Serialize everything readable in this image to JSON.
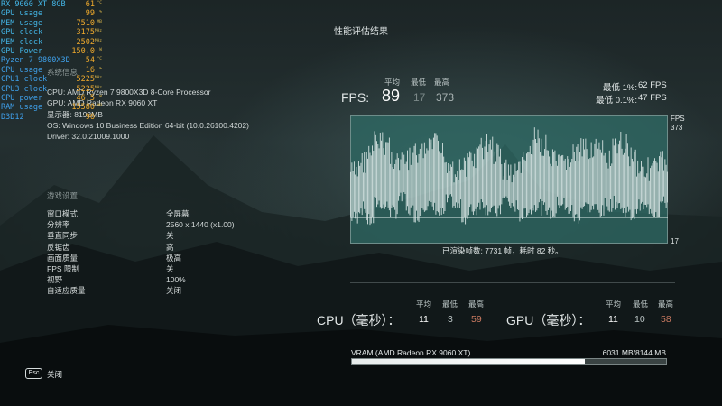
{
  "page": {
    "title": "性能评估结果"
  },
  "osd": [
    {
      "label": "RX 9060 XT 8GB",
      "value": "61",
      "unit": "°C",
      "kind": "gpu"
    },
    {
      "label": "GPU usage",
      "value": "99",
      "unit": "%",
      "kind": "gpu"
    },
    {
      "label": "MEM  usage",
      "value": "7510",
      "unit": "MB",
      "kind": "gpu"
    },
    {
      "label": "GPU clock",
      "value": "3175",
      "unit": "MHz",
      "kind": "gpu"
    },
    {
      "label": "MEM clock",
      "value": "2502",
      "unit": "MHz",
      "kind": "gpu"
    },
    {
      "label": "GPU Power",
      "value": "150.0",
      "unit": "W",
      "kind": "gpu"
    },
    {
      "label": "Ryzen 7 9800X3D",
      "value": "54",
      "unit": "°C",
      "kind": "cpu"
    },
    {
      "label": "CPU usage",
      "value": "16",
      "unit": "%",
      "kind": "cpu"
    },
    {
      "label": "CPU1 clock",
      "value": "5225",
      "unit": "MHz",
      "kind": "cpu"
    },
    {
      "label": "CPU3 clock",
      "value": "5225",
      "unit": "MHz",
      "kind": "cpu"
    },
    {
      "label": "CPU power",
      "value": "46.5",
      "unit": "W",
      "kind": "cpu"
    },
    {
      "label": "RAM usage",
      "value": "15580",
      "unit": "MB",
      "kind": "cpu"
    },
    {
      "label": "D3D12",
      "value": "96",
      "unit": "",
      "kind": "cpu"
    }
  ],
  "system": {
    "heading": "系统信息",
    "lines": [
      "CPU: AMD Ryzen 7 9800X3D 8-Core Processor",
      "GPU: AMD Radeon RX 9060 XT",
      "显示器: 8192MB",
      "OS: Windows 10 Business Edition 64-bit (10.0.26100.4202)",
      "Driver: 32.0.21009.1000"
    ]
  },
  "settings": {
    "heading": "游戏设置",
    "rows": [
      {
        "label": "窗口模式",
        "value": "全屏幕"
      },
      {
        "label": "分辨率",
        "value": "2560 x 1440 (x1.00)"
      },
      {
        "label": "垂直同步",
        "value": "关"
      },
      {
        "label": "反锯齿",
        "value": "高"
      },
      {
        "label": "画面质量",
        "value": "极高"
      },
      {
        "label": "FPS 限制",
        "value": "关"
      },
      {
        "label": "视野",
        "value": "100%"
      },
      {
        "label": "自适应质量",
        "value": "关闭"
      }
    ]
  },
  "fps": {
    "label": "FPS:",
    "head_avg": "平均",
    "head_min": "最低",
    "head_max": "最高",
    "avg": "89",
    "min": "17",
    "max": "373",
    "low1_label": "最低 1%:",
    "low1_value": "62 FPS",
    "low01_label": "最低 0.1%:",
    "low01_value": "47 FPS",
    "frames_summary": "已渲染帧数: 7731 帧，耗时 82 秒。"
  },
  "chart_data": {
    "type": "line",
    "title": "",
    "ylabel": "FPS",
    "ylim": [
      17,
      373
    ],
    "y_top_label": "373",
    "y_bottom_label": "17",
    "average": 89,
    "envelope_note": "frame-rate trace spikes between ~40 and ~340 FPS over the run",
    "upper": [
      250,
      280,
      300,
      335,
      330,
      290,
      270,
      285,
      300,
      310,
      330,
      305,
      275,
      255,
      270,
      290,
      315,
      330,
      300,
      260,
      245,
      275,
      305,
      340,
      320,
      280,
      270,
      285,
      300,
      310,
      320,
      305,
      285,
      310,
      330,
      300,
      270,
      260,
      265,
      280
    ],
    "lower": [
      70,
      95,
      60,
      110,
      100,
      85,
      120,
      90,
      75,
      105,
      95,
      80,
      115,
      100,
      70,
      90,
      110,
      95,
      85,
      120,
      100,
      75,
      90,
      105,
      95,
      80,
      110,
      90,
      70,
      100,
      95,
      85,
      105,
      110,
      90,
      75,
      100,
      95,
      85,
      110
    ]
  },
  "cpu_timing": {
    "label": "CPU（毫秒）：",
    "head_avg": "平均",
    "head_min": "最低",
    "head_max": "最高",
    "avg": "11",
    "min": "3",
    "max": "59"
  },
  "gpu_timing": {
    "label": "GPU（毫秒）：",
    "head_avg": "平均",
    "head_min": "最低",
    "head_max": "最高",
    "avg": "11",
    "min": "10",
    "max": "58"
  },
  "vram": {
    "label": "VRAM (AMD Radeon RX 9060 XT)",
    "value": "6031 MB/8144 MB",
    "used_mb": 6031,
    "total_mb": 8144
  },
  "footer": {
    "key": "Esc",
    "label": "关闭"
  },
  "colors": {
    "osd_gpu": "#43b5e6",
    "osd_cpu": "#3fa0ea",
    "osd_value": "#f0aa2c",
    "max_value": "#c97960",
    "graph_fill": "#2f6b66"
  }
}
